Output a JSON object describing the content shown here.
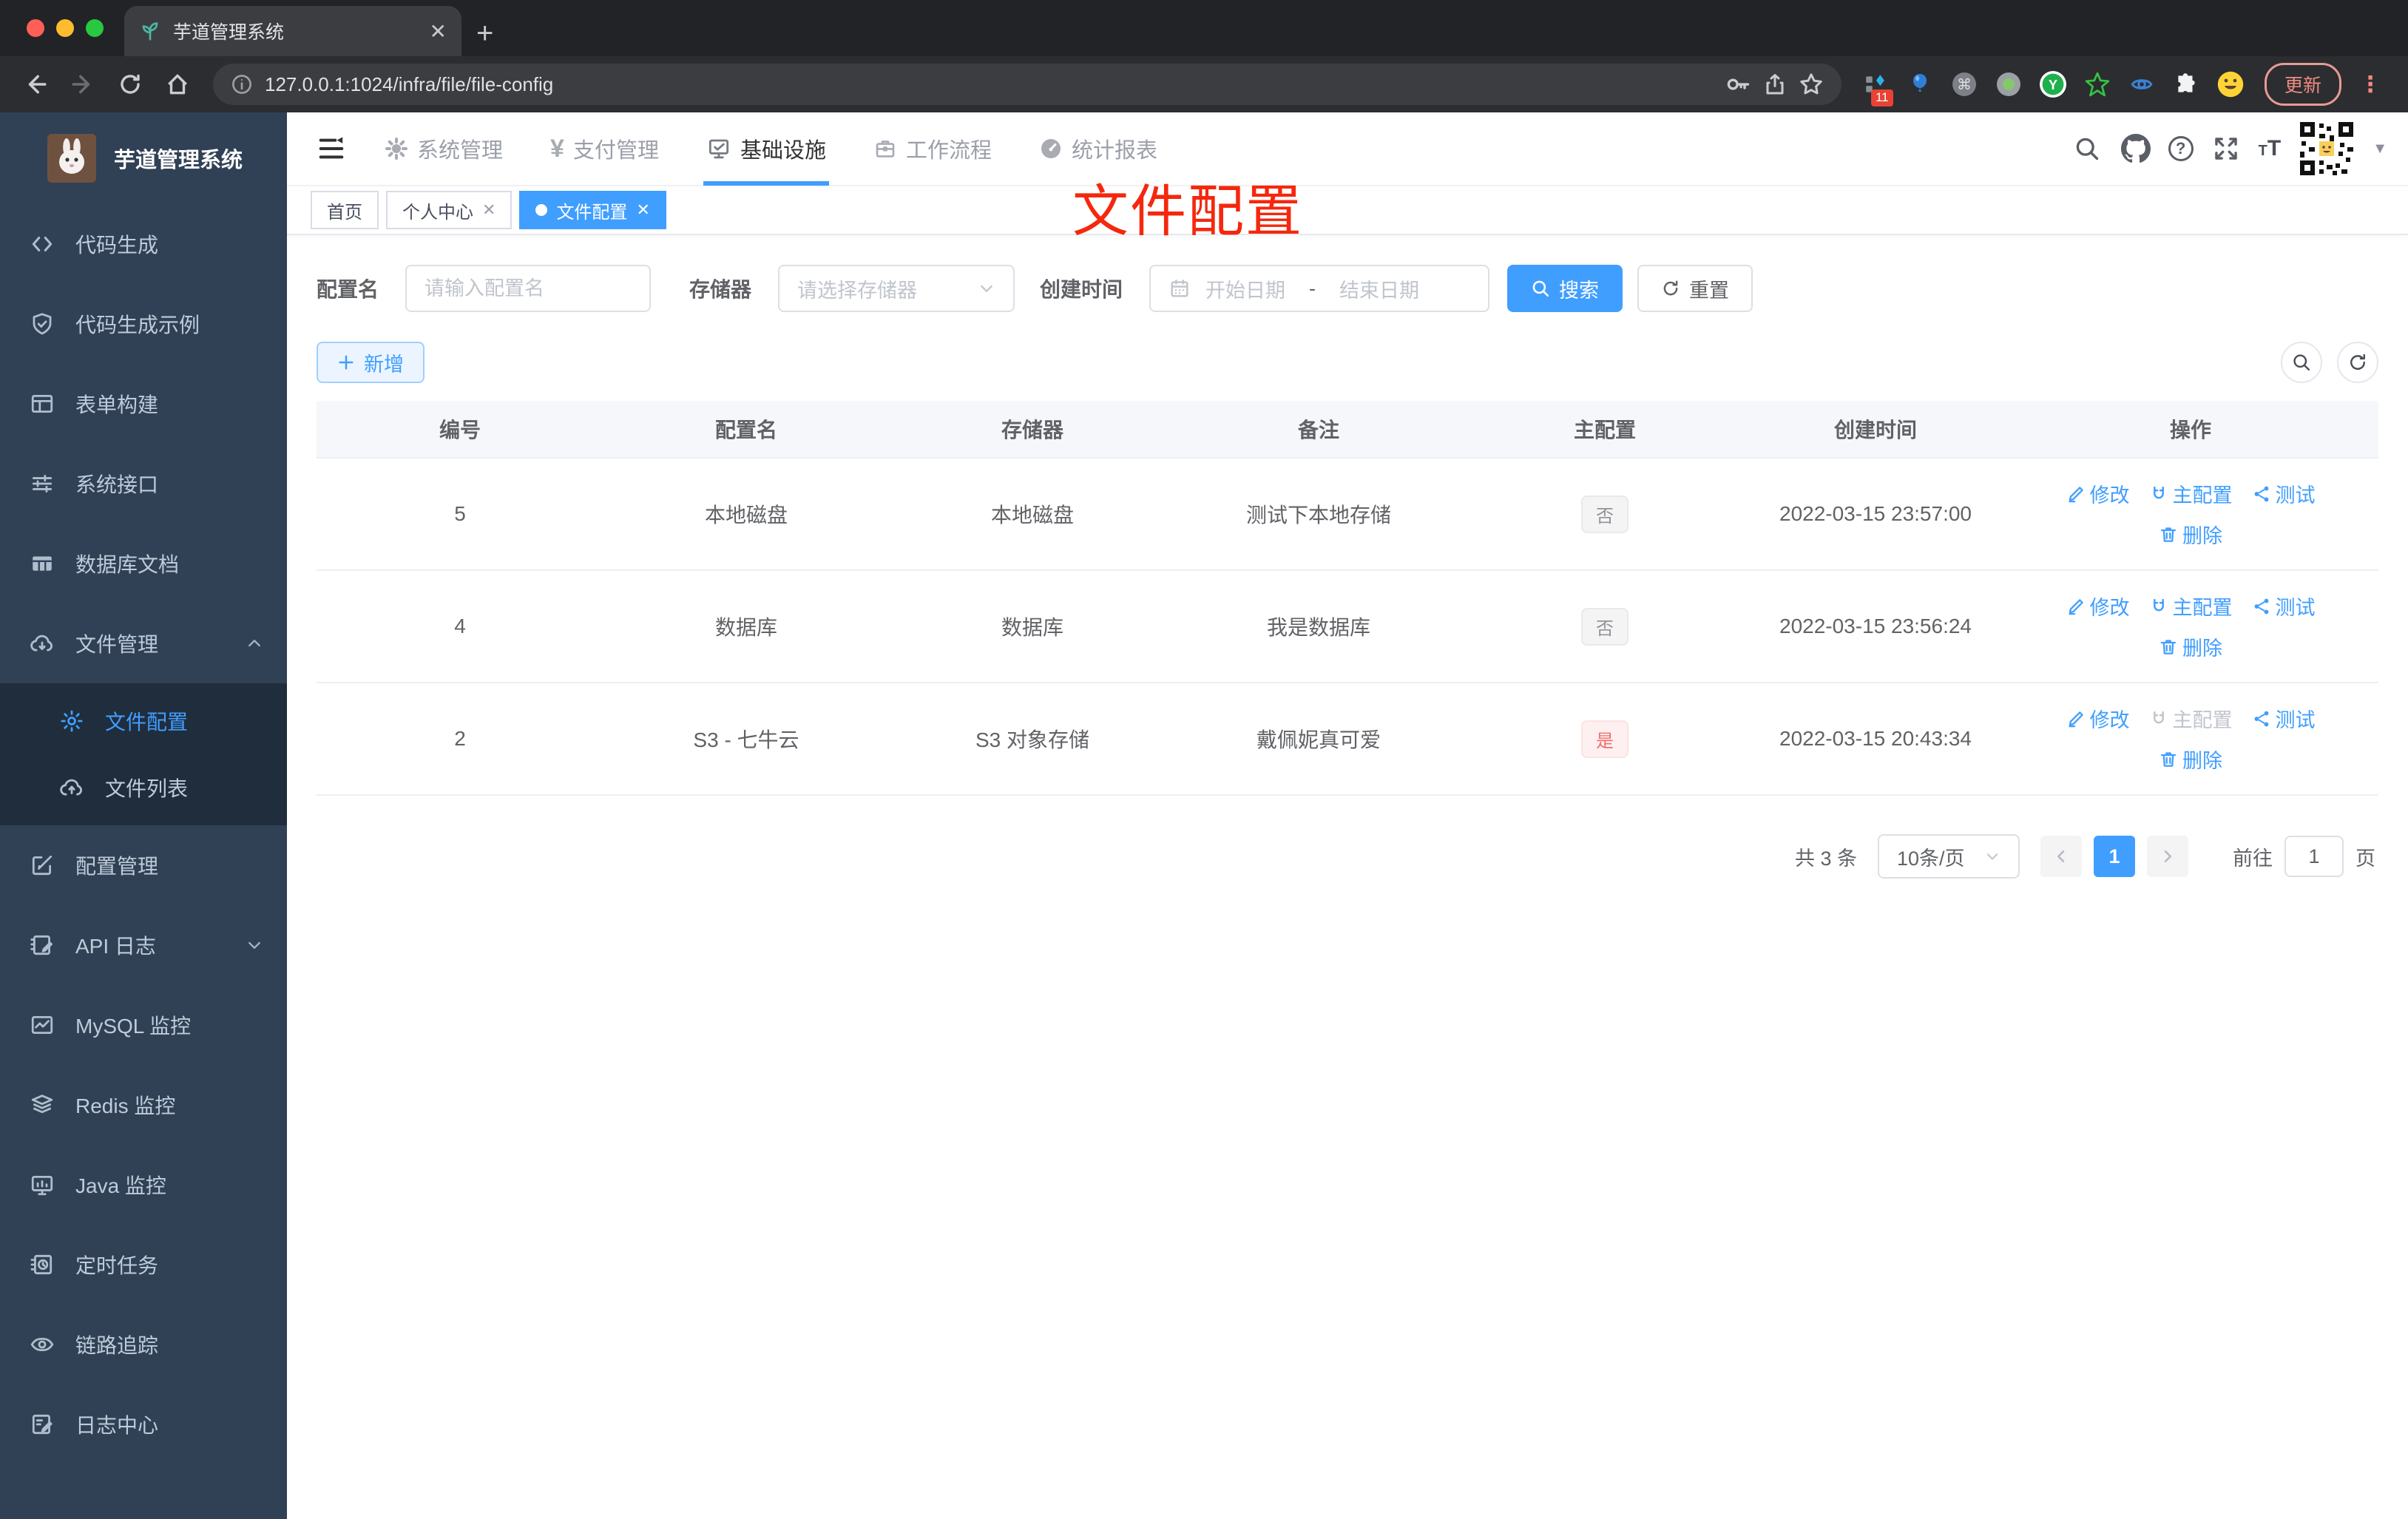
{
  "browser": {
    "tab_title": "芋道管理系统",
    "url": "127.0.0.1:1024/infra/file/file-config",
    "update_label": "更新",
    "extension_badge": "11"
  },
  "sidebar": {
    "title": "芋道管理系统",
    "menu": [
      {
        "label": "代码生成",
        "icon": "code-icon"
      },
      {
        "label": "代码生成示例",
        "icon": "shield-check-icon"
      },
      {
        "label": "表单构建",
        "icon": "form-icon"
      },
      {
        "label": "系统接口",
        "icon": "sliders-icon"
      },
      {
        "label": "数据库文档",
        "icon": "table-icon"
      },
      {
        "label": "文件管理",
        "icon": "cloud-download-icon",
        "expanded": true
      },
      {
        "label": "文件配置",
        "icon": "gear-icon",
        "active": true,
        "sub": true
      },
      {
        "label": "文件列表",
        "icon": "cloud-upload-icon",
        "sub": true
      },
      {
        "label": "配置管理",
        "icon": "edit-square-icon"
      },
      {
        "label": "API 日志",
        "icon": "document-edit-icon",
        "collapsed": true
      },
      {
        "label": "MySQL 监控",
        "icon": "chart-icon"
      },
      {
        "label": "Redis 监控",
        "icon": "layers-icon"
      },
      {
        "label": "Java 监控",
        "icon": "monitor-icon"
      },
      {
        "label": "定时任务",
        "icon": "schedule-icon"
      },
      {
        "label": "链路追踪",
        "icon": "eye-icon"
      },
      {
        "label": "日志中心",
        "icon": "log-edit-icon"
      }
    ]
  },
  "topnav": {
    "items": [
      {
        "label": "系统管理",
        "icon": "gear-icon"
      },
      {
        "label": "支付管理",
        "icon": "yen-icon"
      },
      {
        "label": "基础设施",
        "icon": "infra-monitor-icon",
        "active": true
      },
      {
        "label": "工作流程",
        "icon": "briefcase-icon"
      },
      {
        "label": "统计报表",
        "icon": "gauge-icon"
      }
    ]
  },
  "tags": [
    {
      "label": "首页"
    },
    {
      "label": "个人中心",
      "closable": true
    },
    {
      "label": "文件配置",
      "closable": true,
      "active": true
    }
  ],
  "annotation": {
    "text": "文件配置",
    "color": "#f5270d"
  },
  "filters": {
    "name_label": "配置名",
    "name_placeholder": "请输入配置名",
    "storage_label": "存储器",
    "storage_placeholder": "请选择存储器",
    "time_label": "创建时间",
    "start_placeholder": "开始日期",
    "separator": "-",
    "end_placeholder": "结束日期",
    "search_label": "搜索",
    "reset_label": "重置"
  },
  "toolbar": {
    "add_label": "新增"
  },
  "table": {
    "columns": [
      "编号",
      "配置名",
      "存储器",
      "备注",
      "主配置",
      "创建时间",
      "操作"
    ],
    "actions": {
      "edit": "修改",
      "master": "主配置",
      "test": "测试",
      "delete": "删除"
    },
    "rows": [
      {
        "id": "5",
        "name": "本地磁盘",
        "storage": "本地磁盘",
        "remark": "测试下本地存储",
        "master": "否",
        "master_state": "no",
        "created": "2022-03-15 23:57:00",
        "master_action_disabled": false
      },
      {
        "id": "4",
        "name": "数据库",
        "storage": "数据库",
        "remark": "我是数据库",
        "master": "否",
        "master_state": "no",
        "created": "2022-03-15 23:56:24",
        "master_action_disabled": false
      },
      {
        "id": "2",
        "name": "S3 - 七牛云",
        "storage": "S3 对象存储",
        "remark": "戴佩妮真可爱",
        "master": "是",
        "master_state": "yes",
        "created": "2022-03-15 20:43:34",
        "master_action_disabled": true
      }
    ]
  },
  "pagination": {
    "total_text": "共 3 条",
    "page_size": "10条/页",
    "current_page": "1",
    "goto_label": "前往",
    "goto_value": "1",
    "page_unit": "页"
  },
  "colors": {
    "accent": "#409eff",
    "sidebar_bg": "#304156",
    "submenu_bg": "#1f2d3d",
    "danger": "#f56c6c",
    "annotation_red": "#f5270d",
    "tag_gray_text": "#909399",
    "table_header_bg": "#f5f7fa"
  }
}
